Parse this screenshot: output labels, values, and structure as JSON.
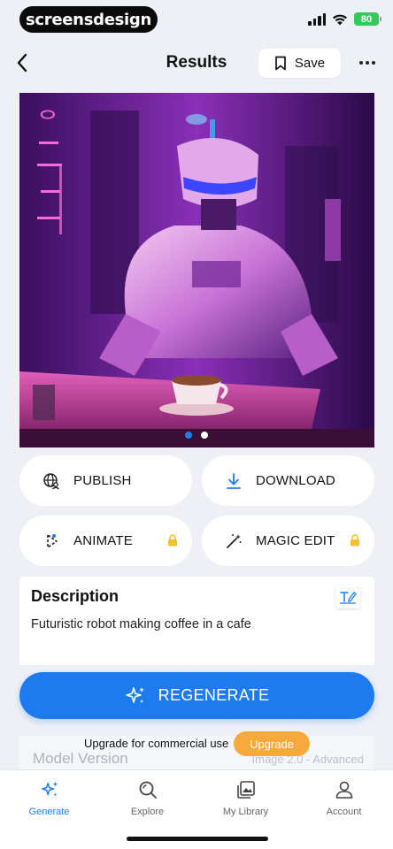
{
  "status_bar": {
    "brand": "screensdesign",
    "battery": "80"
  },
  "header": {
    "title": "Results",
    "save_label": "Save"
  },
  "actions": {
    "publish": "PUBLISH",
    "download": "DOWNLOAD",
    "animate": "ANIMATE",
    "magic_edit": "MAGIC EDIT"
  },
  "description": {
    "title": "Description",
    "text": "Futuristic robot making coffee in a cafe"
  },
  "regenerate_label": "REGENERATE",
  "model": {
    "label": "Model Version",
    "value": "Image 2.0 - Advanced"
  },
  "upgrade": {
    "text": "Upgrade for commercial use",
    "button": "Upgrade"
  },
  "tabs": [
    {
      "label": "Generate",
      "icon": "sparkle-icon",
      "active": true
    },
    {
      "label": "Explore",
      "icon": "search-icon",
      "active": false
    },
    {
      "label": "My Library",
      "icon": "gallery-icon",
      "active": false
    },
    {
      "label": "Account",
      "icon": "person-icon",
      "active": false
    }
  ],
  "carousel": {
    "count": 2,
    "active_index": 0
  },
  "colors": {
    "accent": "#1e7bef",
    "upgrade": "#f7a93b",
    "lock": "#f2c12e"
  }
}
